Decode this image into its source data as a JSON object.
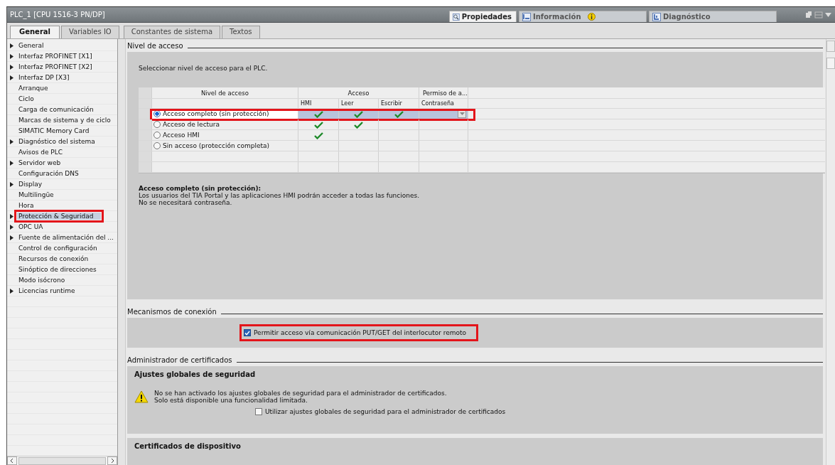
{
  "window": {
    "title": "PLC_1 [CPU 1516-3 PN/DP]"
  },
  "inspector_tabs": [
    {
      "label": "Propiedades",
      "kind": "properties",
      "selected": true
    },
    {
      "label": "Información",
      "kind": "info",
      "selected": false,
      "badge": true
    },
    {
      "label": "Diagnóstico",
      "kind": "diagnostics",
      "selected": false
    }
  ],
  "tabs": [
    {
      "label": "General",
      "selected": true
    },
    {
      "label": "Variables IO",
      "selected": false
    },
    {
      "label": "Constantes de sistema",
      "selected": false
    },
    {
      "label": "Textos",
      "selected": false
    }
  ],
  "sidebar": {
    "items": [
      {
        "label": "General",
        "expandable": true,
        "selected": false,
        "highlighted": false
      },
      {
        "label": "Interfaz PROFINET [X1]",
        "expandable": true,
        "selected": false,
        "highlighted": false
      },
      {
        "label": "Interfaz PROFINET [X2]",
        "expandable": true,
        "selected": false,
        "highlighted": false
      },
      {
        "label": "Interfaz DP [X3]",
        "expandable": true,
        "selected": false,
        "highlighted": false
      },
      {
        "label": "Arranque",
        "expandable": false,
        "selected": false,
        "highlighted": false
      },
      {
        "label": "Ciclo",
        "expandable": false,
        "selected": false,
        "highlighted": false
      },
      {
        "label": "Carga de comunicación",
        "expandable": false,
        "selected": false,
        "highlighted": false
      },
      {
        "label": "Marcas de sistema y de ciclo",
        "expandable": false,
        "selected": false,
        "highlighted": false
      },
      {
        "label": "SIMATIC Memory Card",
        "expandable": false,
        "selected": false,
        "highlighted": false
      },
      {
        "label": "Diagnóstico del sistema",
        "expandable": true,
        "selected": false,
        "highlighted": false
      },
      {
        "label": "Avisos de PLC",
        "expandable": false,
        "selected": false,
        "highlighted": false
      },
      {
        "label": "Servidor web",
        "expandable": true,
        "selected": false,
        "highlighted": false
      },
      {
        "label": "Configuración DNS",
        "expandable": false,
        "selected": false,
        "highlighted": false
      },
      {
        "label": "Display",
        "expandable": true,
        "selected": false,
        "highlighted": false
      },
      {
        "label": "Multilingüe",
        "expandable": false,
        "selected": false,
        "highlighted": false
      },
      {
        "label": "Hora",
        "expandable": false,
        "selected": false,
        "highlighted": false
      },
      {
        "label": "Protección & Seguridad",
        "expandable": true,
        "selected": true,
        "highlighted": true
      },
      {
        "label": "OPC UA",
        "expandable": true,
        "selected": false,
        "highlighted": false
      },
      {
        "label": "Fuente de alimentación del ...",
        "expandable": true,
        "selected": false,
        "highlighted": false
      },
      {
        "label": "Control de configuración",
        "expandable": false,
        "selected": false,
        "highlighted": false
      },
      {
        "label": "Recursos de conexión",
        "expandable": false,
        "selected": false,
        "highlighted": false
      },
      {
        "label": "Sinóptico de direcciones",
        "expandable": false,
        "selected": false,
        "highlighted": false
      },
      {
        "label": "Modo isócrono",
        "expandable": false,
        "selected": false,
        "highlighted": false
      },
      {
        "label": "Licencias runtime",
        "expandable": true,
        "selected": false,
        "highlighted": false
      }
    ]
  },
  "access_level": {
    "heading": "Nivel de acceso",
    "intro": "Seleccionar nivel de acceso para el PLC.",
    "columns": [
      {
        "label": "Nivel de acceso"
      },
      {
        "label": "Acceso"
      },
      {
        "label": "Permiso de a..."
      }
    ],
    "subcolumns": [
      "HMI",
      "Leer",
      "Escribir",
      "Contraseña"
    ],
    "rows": [
      {
        "label": "Acceso completo (sin protección)",
        "selected": true,
        "highlighted": true,
        "hmi": true,
        "read": true,
        "write": true,
        "dropdown": true
      },
      {
        "label": "Acceso de lectura",
        "selected": false,
        "highlighted": false,
        "hmi": true,
        "read": true,
        "write": false,
        "dropdown": false
      },
      {
        "label": "Acceso HMI",
        "selected": false,
        "highlighted": false,
        "hmi": true,
        "read": false,
        "write": false,
        "dropdown": false
      },
      {
        "label": "Sin acceso (protección completa)",
        "selected": false,
        "highlighted": false,
        "hmi": false,
        "read": false,
        "write": false,
        "dropdown": false
      }
    ],
    "description_title": "Acceso completo (sin protección):",
    "description_lines": [
      "Los usuarios del TIA Portal y las aplicaciones HMI podrán acceder a todas las funciones.",
      "No se necesitará contraseña."
    ]
  },
  "connection": {
    "heading": "Mecanismos de conexión",
    "option": {
      "label": "Permitir acceso vía comunicación PUT/GET del interlocutor remoto",
      "checked": true,
      "highlighted": true
    }
  },
  "certificates": {
    "heading": "Administrador de certificados",
    "global_title": "Ajustes globales de seguridad",
    "warning_lines": [
      "No se han activado los ajustes globales de seguridad para el administrador de certificados.",
      "Solo está disponible una funcionalidad limitada."
    ],
    "option": {
      "label": "Utilizar ajustes globales de seguridad para el administrador de certificados",
      "checked": false
    },
    "device_title": "Certificados de dispositivo"
  }
}
